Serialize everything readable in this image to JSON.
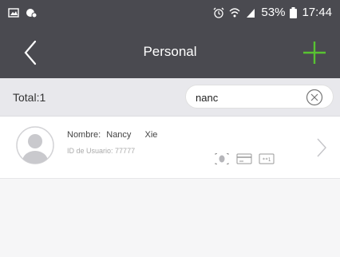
{
  "status_bar": {
    "battery_percent": "53%",
    "time": "17:44",
    "icons": [
      "gallery-icon",
      "notification-icon",
      "alarm-icon",
      "wifi-icon",
      "signal-icon",
      "battery-icon"
    ]
  },
  "nav": {
    "title": "Personal",
    "back_icon": "chevron-left-icon",
    "add_icon": "plus-icon",
    "accent_color": "#58c332"
  },
  "filter": {
    "total_label": "Total:1",
    "search_value": "nanc",
    "clear_icon": "clear-circle-icon"
  },
  "users": [
    {
      "name_label": "Nombre:",
      "first_name": "Nancy",
      "last_name": "Xie",
      "id_label": "ID de Usuario:",
      "id": "77777",
      "credential_icons": [
        "fingerprint-icon",
        "card-icon",
        "password-icon"
      ],
      "password_text": "**1"
    }
  ]
}
